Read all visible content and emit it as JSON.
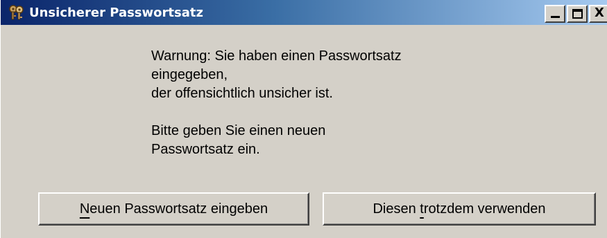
{
  "window": {
    "title": "Unsicherer Passwortsatz",
    "icon": "keyring-icon"
  },
  "title_controls": {
    "minimize_icon": "minimize-icon",
    "maximize_icon": "maximize-icon",
    "close_label": "X"
  },
  "message": {
    "line1": "Warnung: Sie haben einen Passwortsatz",
    "line2": "eingegeben,",
    "line3": "der offensichtlich unsicher ist.",
    "line4": "Bitte geben Sie einen neuen",
    "line5": "Passwortsatz ein."
  },
  "buttons": {
    "new_passphrase": {
      "mnemonic": "N",
      "rest": "euen Passwortsatz eingeben"
    },
    "use_anyway": {
      "before": "Diesen ",
      "mnemonic": "t",
      "after": "rotzdem verwenden"
    }
  },
  "colors": {
    "titlebar_start": "#0a246a",
    "titlebar_end": "#a6caf0",
    "dialog_face": "#d4d0c8"
  }
}
